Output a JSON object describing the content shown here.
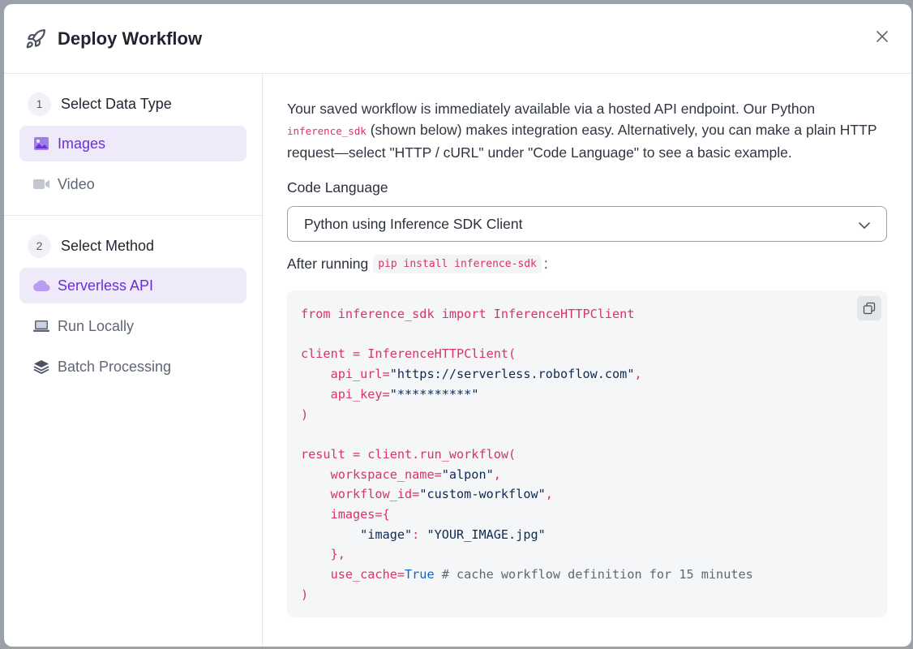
{
  "header": {
    "title": "Deploy Workflow",
    "icon": "rocket-icon",
    "close_icon": "close-icon"
  },
  "sidebar": {
    "sections": [
      {
        "number": "1",
        "title": "Select Data Type",
        "items": [
          {
            "label": "Images",
            "icon": "image-icon",
            "active": true
          },
          {
            "label": "Video",
            "icon": "video-camera-icon",
            "active": false
          }
        ]
      },
      {
        "number": "2",
        "title": "Select Method",
        "items": [
          {
            "label": "Serverless API",
            "icon": "cloud-icon",
            "active": true
          },
          {
            "label": "Run Locally",
            "icon": "laptop-icon",
            "active": false
          },
          {
            "label": "Batch Processing",
            "icon": "layers-icon",
            "active": false
          }
        ]
      }
    ]
  },
  "main": {
    "intro_part1": "Your saved workflow is immediately available via a hosted API endpoint. Our Python ",
    "intro_code": "inference_sdk",
    "intro_part2": " (shown below) makes integration easy. Alternatively, you can make a plain HTTP request—select \"HTTP / cURL\" under \"Code Language\" to see a basic example.",
    "code_language_label": "Code Language",
    "code_language_value": "Python using Inference SDK Client",
    "after_running_label": "After running",
    "pip_command": "pip install inference-sdk",
    "after_running_suffix": ":",
    "code": {
      "l1_from": "from inference_sdk import InferenceHTTPClient",
      "l3": "client = InferenceHTTPClient(",
      "l4_key": "    api_url=",
      "l4_val": "\"https://serverless.roboflow.com\"",
      "l4_end": ",",
      "l5_key": "    api_key=",
      "l5_val": "\"**********\"",
      "l6": ")",
      "l8": "result = client.run_workflow(",
      "l9_key": "    workspace_name=",
      "l9_val": "\"alpon\"",
      "l9_end": ",",
      "l10_key": "    workflow_id=",
      "l10_val": "\"custom-workflow\"",
      "l10_end": ",",
      "l11": "    images={",
      "l12_pre": "        ",
      "l12_key": "\"image\"",
      "l12_colon": ": ",
      "l12_val": "\"YOUR_IMAGE.jpg\"",
      "l13": "    },",
      "l14_key": "    use_cache=",
      "l14_bool": "True",
      "l14_comment": " # cache workflow definition for 15 minutes",
      "l15": ")"
    },
    "copy_icon": "copy-icon"
  }
}
